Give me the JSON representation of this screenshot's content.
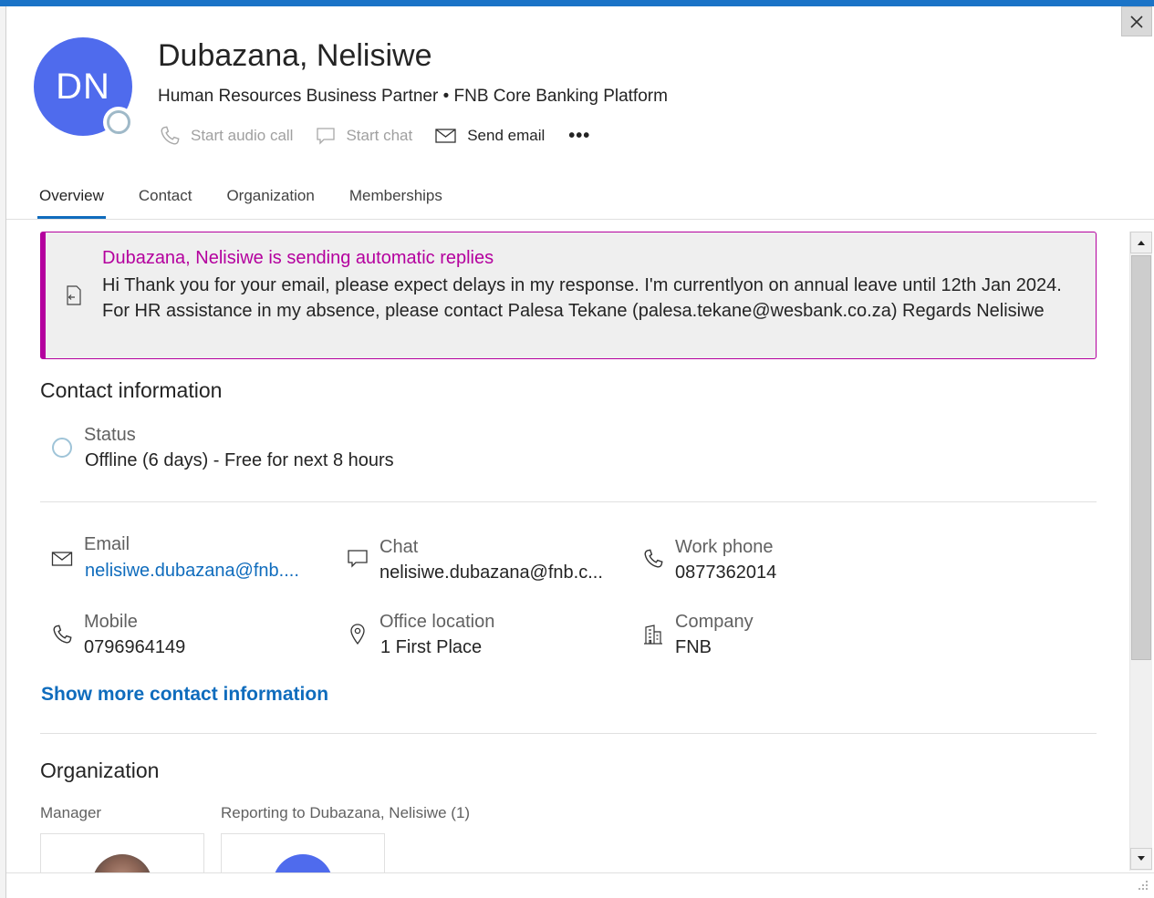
{
  "profile": {
    "initials": "DN",
    "name": "Dubazana, Nelisiwe",
    "subtitle": "Human Resources Business Partner • FNB Core Banking Platform",
    "presence_color": "#9fb9c8",
    "avatar_color": "#4f6bed"
  },
  "actions": {
    "audio_call": "Start audio call",
    "chat": "Start chat",
    "email": "Send email",
    "more": "•••"
  },
  "tabs": [
    {
      "label": "Overview",
      "active": true
    },
    {
      "label": "Contact",
      "active": false
    },
    {
      "label": "Organization",
      "active": false
    },
    {
      "label": "Memberships",
      "active": false
    }
  ],
  "auto_reply": {
    "title": "Dubazana, Nelisiwe is sending automatic replies",
    "body": "Hi  Thank you for your email, please expect delays in my response. I'm currentlyon on annual leave until 12th Jan 2024.   For HR assistance in my absence, please contact Palesa Tekane (palesa.tekane@wesbank.co.za)   Regards Nelisiwe",
    "accent_color": "#b4009e"
  },
  "contact_info": {
    "heading": "Contact information",
    "status_label": "Status",
    "status_value": "Offline (6 days) - Free for next 8 hours",
    "email_label": "Email",
    "email_value": "nelisiwe.dubazana@fnb....",
    "chat_label": "Chat",
    "chat_value": "nelisiwe.dubazana@fnb.c...",
    "work_phone_label": "Work phone",
    "work_phone_value": "0877362014",
    "mobile_label": "Mobile",
    "mobile_value": "0796964149",
    "office_label": "Office location",
    "office_value": "1 First Place",
    "company_label": "Company",
    "company_value": "FNB",
    "show_more": "Show more contact information"
  },
  "organization": {
    "heading": "Organization",
    "manager_label": "Manager",
    "reports_label": "Reporting to Dubazana, Nelisiwe (1)"
  },
  "window": {
    "close_icon": "close-icon"
  }
}
